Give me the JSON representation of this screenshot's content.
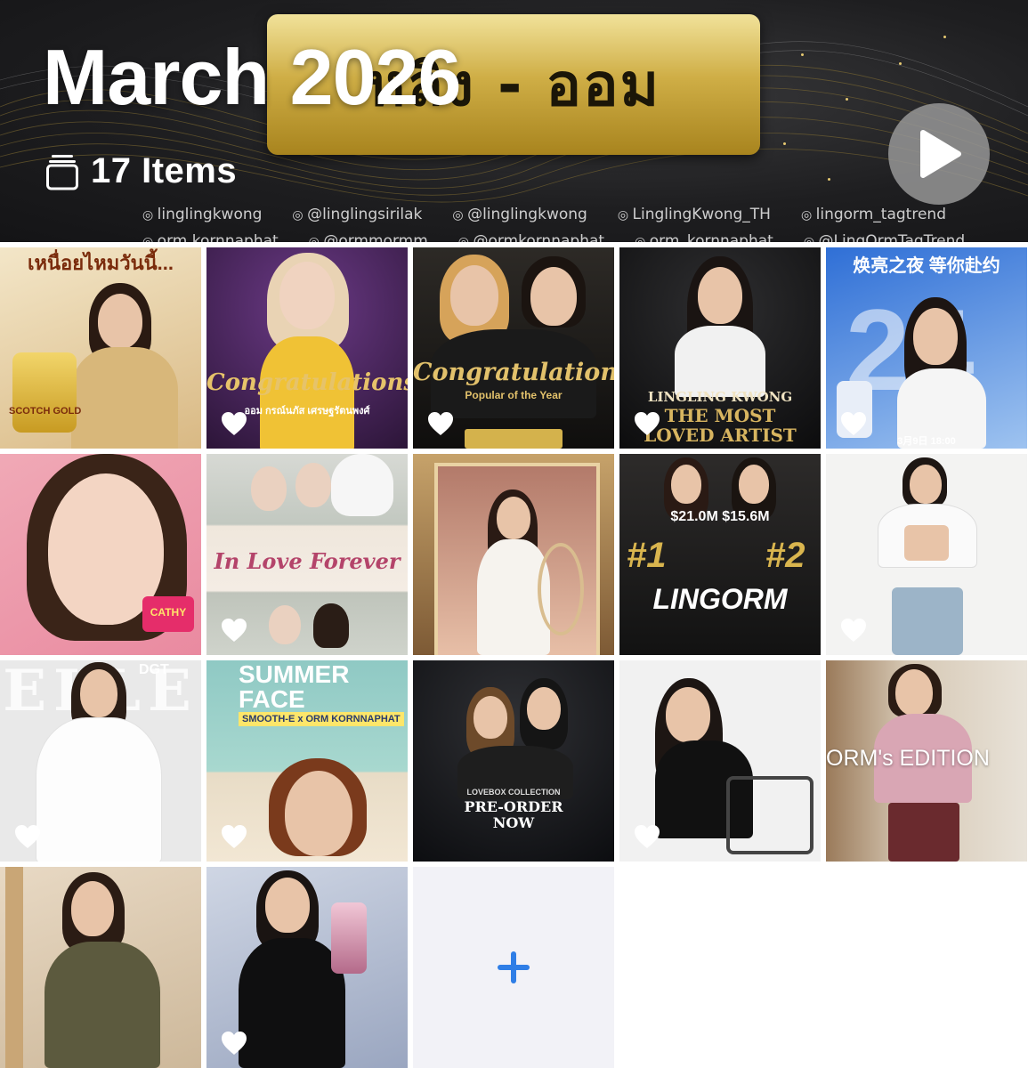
{
  "header": {
    "title": "March 2026",
    "items_count": "17 Items",
    "banner_text": "หลิง - ออม",
    "play_icon": "play-icon",
    "stack_icon": "stack-icon",
    "handles_row1": [
      "linglingkwong",
      "@linglingsirilak",
      "@linglingkwong",
      "LinglingKwong_TH",
      "lingorm_tagtrend"
    ],
    "handles_row2": [
      "orm.kornnaphat",
      "@ormmormm",
      "@ormkornnaphat",
      "orm_kornnaphat",
      "@LingOrmTagTrend"
    ]
  },
  "tiles": [
    {
      "caption": "เหนื่อยไหมวันนี้...",
      "sub": "SCOTCH GOLD",
      "favorite": false
    },
    {
      "caption": "Congratulations",
      "sub": "ออม กรณ์นภัส เศรษฐรัตนพงศ์",
      "favorite": true
    },
    {
      "caption": "Congratulations",
      "sub": "Popular of the Year",
      "favorite": true
    },
    {
      "caption": "THE MOST LOVED ARTIST",
      "sub": "LINGLING KWONG",
      "favorite": true
    },
    {
      "caption": "焕亮之夜 等你赴约",
      "sub": "3月9日 18:00",
      "favorite": true
    },
    {
      "caption": "",
      "sub": "CATHY",
      "favorite": false
    },
    {
      "caption": "In Love Forever",
      "sub": "",
      "favorite": true
    },
    {
      "caption": "",
      "sub": "",
      "favorite": false
    },
    {
      "caption": "LINGORM",
      "sub": "$21.0M  $15.6M",
      "favorite": false
    },
    {
      "caption": "",
      "sub": "",
      "favorite": true
    },
    {
      "caption": "ELLE",
      "sub": "DGT",
      "favorite": true
    },
    {
      "caption": "SUMMER FACE",
      "sub": "SMOOTH-E x ORM KORNNAPHAT",
      "favorite": true
    },
    {
      "caption": "PRE-ORDER NOW",
      "sub": "LOVEBOX COLLECTION",
      "favorite": false
    },
    {
      "caption": "",
      "sub": "",
      "favorite": true
    },
    {
      "caption": "ORM's EDITION",
      "sub": "",
      "favorite": false
    },
    {
      "caption": "",
      "sub": "",
      "favorite": false
    },
    {
      "caption": "",
      "sub": "",
      "favorite": true
    }
  ],
  "add_tile": {
    "icon": "plus-icon"
  },
  "colors": {
    "accent": "#2f7ee6",
    "add_bg": "#f2f2f7",
    "gold": "#d4b24c"
  }
}
